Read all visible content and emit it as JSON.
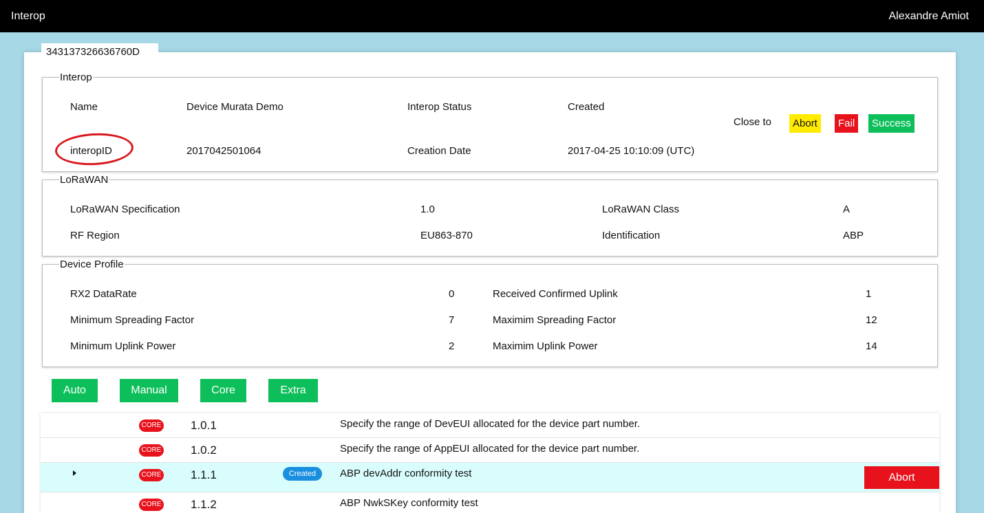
{
  "header": {
    "app_title": "Interop",
    "user_name": "Alexandre Amiot"
  },
  "device_tab": "343137326636760D",
  "interop": {
    "legend": "Interop",
    "name_label": "Name",
    "name_value": "Device Murata Demo",
    "status_label": "Interop Status",
    "status_value": "Created",
    "id_label": "interopID",
    "id_value": "2017042501064",
    "date_label": "Creation Date",
    "date_value": "2017-04-25 10:10:09 (UTC)",
    "close_to_label": "Close to",
    "abort_label": "Abort",
    "fail_label": "Fail",
    "success_label": "Success"
  },
  "lorawan": {
    "legend": "LoRaWAN",
    "spec_label": "LoRaWAN Specification",
    "spec_value": "1.0",
    "class_label": "LoRaWAN Class",
    "class_value": "A",
    "region_label": "RF Region",
    "region_value": "EU863-870",
    "ident_label": "Identification",
    "ident_value": "ABP"
  },
  "profile": {
    "legend": "Device Profile",
    "rx2_label": "RX2 DataRate",
    "rx2_value": "0",
    "rcu_label": "Received Confirmed Uplink",
    "rcu_value": "1",
    "minsf_label": "Minimum Spreading Factor",
    "minsf_value": "7",
    "maxsf_label": "Maximim Spreading Factor",
    "maxsf_value": "12",
    "minpow_label": "Minimum Uplink Power",
    "minpow_value": "2",
    "maxpow_label": "Maximim Uplink Power",
    "maxpow_value": "14"
  },
  "filters": {
    "auto": "Auto",
    "manual": "Manual",
    "core": "Core",
    "extra": "Extra"
  },
  "tests": [
    {
      "badge": "CORE",
      "number": "1.0.1",
      "description": "Specify the range of DevEUI allocated for the device part number."
    },
    {
      "badge": "CORE",
      "number": "1.0.2",
      "description": "Specify the range of AppEUI allocated for the device part number."
    },
    {
      "badge": "CORE",
      "number": "1.1.1",
      "status": "Created",
      "description": "ABP devAddr conformity test",
      "action": "Abort"
    },
    {
      "badge": "CORE",
      "number": "1.1.2",
      "description": "ABP NwkSKey conformity test"
    }
  ],
  "colors": {
    "background": "#a6d8e6",
    "abort_yellow": "#ffeb00",
    "fail_red": "#e8121c",
    "success_green": "#0dbf5a",
    "created_blue": "#1a8fe0",
    "active_row": "#d9fdfd"
  },
  "icons": {
    "expand_caret": "caret-right-icon"
  }
}
